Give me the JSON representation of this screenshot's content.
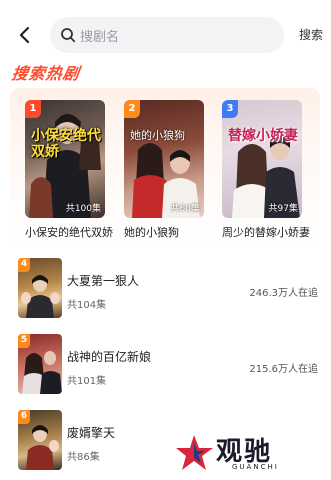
{
  "header": {
    "search_placeholder": "搜剧名",
    "search_button": "搜索"
  },
  "section_title": "搜索热剧",
  "colors": {
    "accent": "#ff4d2e",
    "rank1": "#ff4b2b",
    "rank2": "#ff8a1c",
    "rank3": "#3d7cf5",
    "rank_other": "#ff8a1c"
  },
  "hot": [
    {
      "rank": "1",
      "title": "小保安的绝代双娇",
      "count": "共100集",
      "poster_title": "小保安绝代双娇"
    },
    {
      "rank": "2",
      "title": "她的小狼狗",
      "count": "共60集",
      "poster_title": "她的小狼狗"
    },
    {
      "rank": "3",
      "title": "周少的替嫁小娇妻",
      "count": "共97集",
      "poster_title": "替嫁小娇妻"
    }
  ],
  "list": [
    {
      "rank": "4",
      "title": "大夏第一狠人",
      "eps": "共104集",
      "follow": "246.3万人在追"
    },
    {
      "rank": "5",
      "title": "战神的百亿新娘",
      "eps": "共101集",
      "follow": "215.6万人在追"
    },
    {
      "rank": "6",
      "title": "废婿擎天",
      "eps": "共86集",
      "follow": ""
    }
  ],
  "watermark": {
    "cn": "观驰",
    "en": "GUANCHI"
  },
  "icons": [
    "back-arrow-icon",
    "search-icon",
    "guanchi-logo-icon"
  ]
}
